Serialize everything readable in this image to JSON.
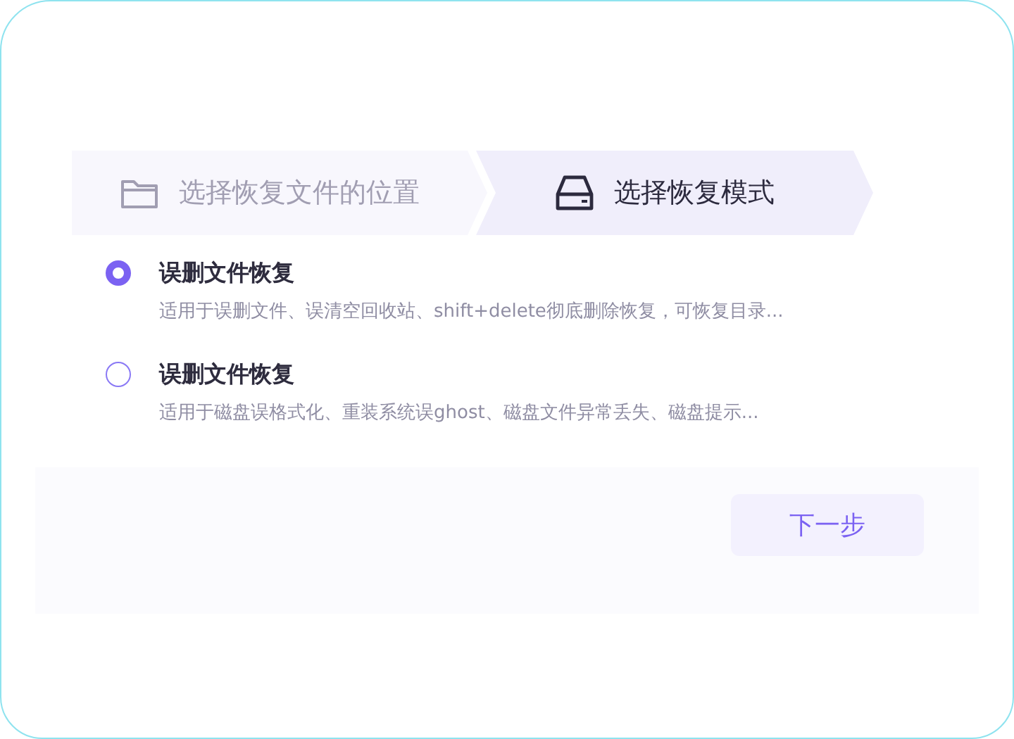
{
  "steps": [
    {
      "label": "选择恢复文件的位置",
      "kind": "folder",
      "selected": false
    },
    {
      "label": "选择恢复模式",
      "kind": "drive",
      "selected": true
    }
  ],
  "options": [
    {
      "title": "误删文件恢复",
      "description": "适用于误删文件、误清空回收站、shift+delete彻底删除恢复，可恢复目录...",
      "selected": true
    },
    {
      "title": "误删文件恢复",
      "description": "适用于磁盘误格式化、重装系统误ghost、磁盘文件异常丢失、磁盘提示...",
      "selected": false
    }
  ],
  "next_button": "下一步"
}
